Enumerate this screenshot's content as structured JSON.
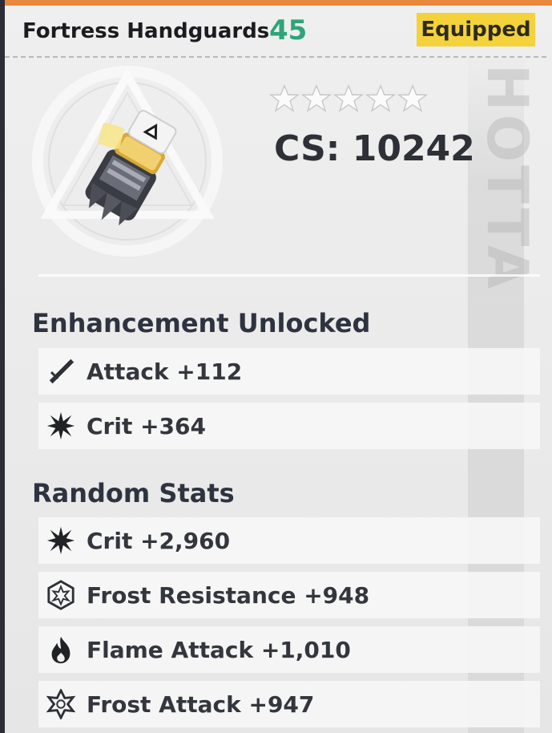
{
  "item": {
    "name": "Fortress Handguards",
    "level": "45",
    "badge": "Equipped",
    "stars_total": 5,
    "stars_filled": 0,
    "cs": "CS: 10242",
    "watermark": "HOTTA"
  },
  "sections": [
    {
      "title": "Enhancement Unlocked",
      "stats": [
        {
          "icon": "sword-icon",
          "text": "Attack +112"
        },
        {
          "icon": "crit-burst-icon",
          "text": "Crit +364"
        }
      ]
    },
    {
      "title": "Random Stats",
      "stats": [
        {
          "icon": "crit-burst-icon",
          "text": "Crit +2,960"
        },
        {
          "icon": "frost-resistance-icon",
          "text": "Frost Resistance +948"
        },
        {
          "icon": "flame-icon",
          "text": "Flame Attack +1,010"
        },
        {
          "icon": "frost-attack-icon",
          "text": "Frost Attack +947"
        }
      ]
    }
  ],
  "colors": {
    "level": "#2ea57a",
    "badge_bg": "#f4d23c",
    "top_bar": "#e8883a"
  }
}
